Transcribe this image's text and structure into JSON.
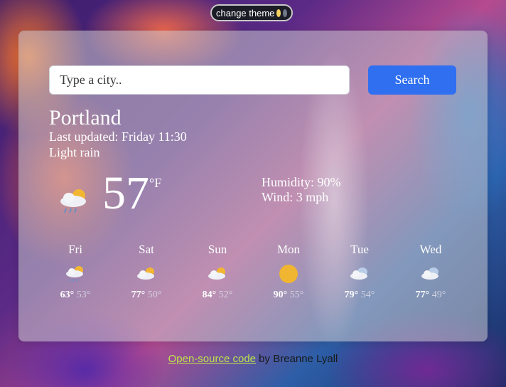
{
  "theme_button": {
    "label": "change theme",
    "icons": [
      "yellow-moon-icon",
      "grey-moon-icon"
    ]
  },
  "search": {
    "placeholder": "Type a city..",
    "button_label": "Search"
  },
  "current": {
    "city": "Portland",
    "updated": "Last updated: Friday 11:30",
    "description": "Light rain",
    "icon": "rain-cloud-sun-icon",
    "temperature": "57",
    "unit": "°F",
    "humidity": "Humidity: 90%",
    "wind": "Wind: 3 mph"
  },
  "forecast": [
    {
      "day": "Fri",
      "high": "63°",
      "low": "53°",
      "icon": "rain-cloud-sun-icon"
    },
    {
      "day": "Sat",
      "high": "77°",
      "low": "50°",
      "icon": "cloud-sun-icon"
    },
    {
      "day": "Sun",
      "high": "84°",
      "low": "52°",
      "icon": "cloud-sun-icon"
    },
    {
      "day": "Mon",
      "high": "90°",
      "low": "55°",
      "icon": "sun-icon"
    },
    {
      "day": "Tue",
      "high": "79°",
      "low": "54°",
      "icon": "cloud-icon"
    },
    {
      "day": "Wed",
      "high": "77°",
      "low": "49°",
      "icon": "cloud-icon"
    }
  ],
  "footer": {
    "link_text": "Open-source code",
    "suffix": " by Breanne Lyall"
  },
  "colors": {
    "accent": "#2f6ff0",
    "link": "#bfe54a"
  }
}
